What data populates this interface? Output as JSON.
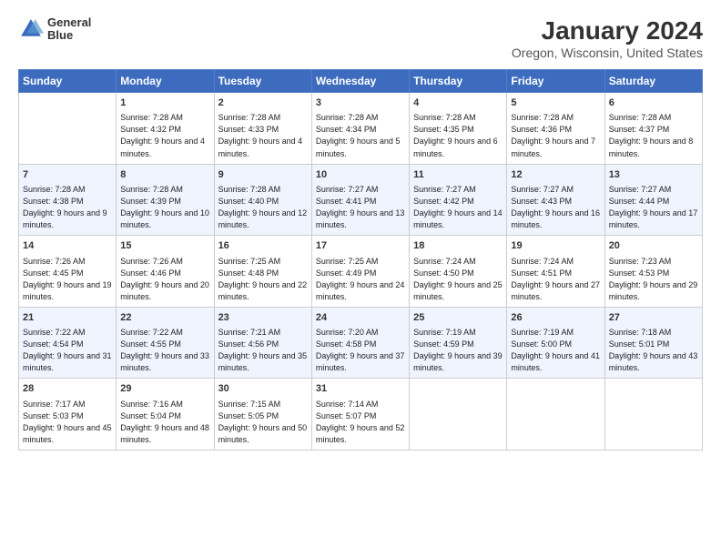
{
  "header": {
    "logo_line1": "General",
    "logo_line2": "Blue",
    "title": "January 2024",
    "subtitle": "Oregon, Wisconsin, United States"
  },
  "days_of_week": [
    "Sunday",
    "Monday",
    "Tuesday",
    "Wednesday",
    "Thursday",
    "Friday",
    "Saturday"
  ],
  "weeks": [
    [
      {
        "num": "",
        "sunrise": "",
        "sunset": "",
        "daylight": ""
      },
      {
        "num": "1",
        "sunrise": "Sunrise: 7:28 AM",
        "sunset": "Sunset: 4:32 PM",
        "daylight": "Daylight: 9 hours and 4 minutes."
      },
      {
        "num": "2",
        "sunrise": "Sunrise: 7:28 AM",
        "sunset": "Sunset: 4:33 PM",
        "daylight": "Daylight: 9 hours and 4 minutes."
      },
      {
        "num": "3",
        "sunrise": "Sunrise: 7:28 AM",
        "sunset": "Sunset: 4:34 PM",
        "daylight": "Daylight: 9 hours and 5 minutes."
      },
      {
        "num": "4",
        "sunrise": "Sunrise: 7:28 AM",
        "sunset": "Sunset: 4:35 PM",
        "daylight": "Daylight: 9 hours and 6 minutes."
      },
      {
        "num": "5",
        "sunrise": "Sunrise: 7:28 AM",
        "sunset": "Sunset: 4:36 PM",
        "daylight": "Daylight: 9 hours and 7 minutes."
      },
      {
        "num": "6",
        "sunrise": "Sunrise: 7:28 AM",
        "sunset": "Sunset: 4:37 PM",
        "daylight": "Daylight: 9 hours and 8 minutes."
      }
    ],
    [
      {
        "num": "7",
        "sunrise": "Sunrise: 7:28 AM",
        "sunset": "Sunset: 4:38 PM",
        "daylight": "Daylight: 9 hours and 9 minutes."
      },
      {
        "num": "8",
        "sunrise": "Sunrise: 7:28 AM",
        "sunset": "Sunset: 4:39 PM",
        "daylight": "Daylight: 9 hours and 10 minutes."
      },
      {
        "num": "9",
        "sunrise": "Sunrise: 7:28 AM",
        "sunset": "Sunset: 4:40 PM",
        "daylight": "Daylight: 9 hours and 12 minutes."
      },
      {
        "num": "10",
        "sunrise": "Sunrise: 7:27 AM",
        "sunset": "Sunset: 4:41 PM",
        "daylight": "Daylight: 9 hours and 13 minutes."
      },
      {
        "num": "11",
        "sunrise": "Sunrise: 7:27 AM",
        "sunset": "Sunset: 4:42 PM",
        "daylight": "Daylight: 9 hours and 14 minutes."
      },
      {
        "num": "12",
        "sunrise": "Sunrise: 7:27 AM",
        "sunset": "Sunset: 4:43 PM",
        "daylight": "Daylight: 9 hours and 16 minutes."
      },
      {
        "num": "13",
        "sunrise": "Sunrise: 7:27 AM",
        "sunset": "Sunset: 4:44 PM",
        "daylight": "Daylight: 9 hours and 17 minutes."
      }
    ],
    [
      {
        "num": "14",
        "sunrise": "Sunrise: 7:26 AM",
        "sunset": "Sunset: 4:45 PM",
        "daylight": "Daylight: 9 hours and 19 minutes."
      },
      {
        "num": "15",
        "sunrise": "Sunrise: 7:26 AM",
        "sunset": "Sunset: 4:46 PM",
        "daylight": "Daylight: 9 hours and 20 minutes."
      },
      {
        "num": "16",
        "sunrise": "Sunrise: 7:25 AM",
        "sunset": "Sunset: 4:48 PM",
        "daylight": "Daylight: 9 hours and 22 minutes."
      },
      {
        "num": "17",
        "sunrise": "Sunrise: 7:25 AM",
        "sunset": "Sunset: 4:49 PM",
        "daylight": "Daylight: 9 hours and 24 minutes."
      },
      {
        "num": "18",
        "sunrise": "Sunrise: 7:24 AM",
        "sunset": "Sunset: 4:50 PM",
        "daylight": "Daylight: 9 hours and 25 minutes."
      },
      {
        "num": "19",
        "sunrise": "Sunrise: 7:24 AM",
        "sunset": "Sunset: 4:51 PM",
        "daylight": "Daylight: 9 hours and 27 minutes."
      },
      {
        "num": "20",
        "sunrise": "Sunrise: 7:23 AM",
        "sunset": "Sunset: 4:53 PM",
        "daylight": "Daylight: 9 hours and 29 minutes."
      }
    ],
    [
      {
        "num": "21",
        "sunrise": "Sunrise: 7:22 AM",
        "sunset": "Sunset: 4:54 PM",
        "daylight": "Daylight: 9 hours and 31 minutes."
      },
      {
        "num": "22",
        "sunrise": "Sunrise: 7:22 AM",
        "sunset": "Sunset: 4:55 PM",
        "daylight": "Daylight: 9 hours and 33 minutes."
      },
      {
        "num": "23",
        "sunrise": "Sunrise: 7:21 AM",
        "sunset": "Sunset: 4:56 PM",
        "daylight": "Daylight: 9 hours and 35 minutes."
      },
      {
        "num": "24",
        "sunrise": "Sunrise: 7:20 AM",
        "sunset": "Sunset: 4:58 PM",
        "daylight": "Daylight: 9 hours and 37 minutes."
      },
      {
        "num": "25",
        "sunrise": "Sunrise: 7:19 AM",
        "sunset": "Sunset: 4:59 PM",
        "daylight": "Daylight: 9 hours and 39 minutes."
      },
      {
        "num": "26",
        "sunrise": "Sunrise: 7:19 AM",
        "sunset": "Sunset: 5:00 PM",
        "daylight": "Daylight: 9 hours and 41 minutes."
      },
      {
        "num": "27",
        "sunrise": "Sunrise: 7:18 AM",
        "sunset": "Sunset: 5:01 PM",
        "daylight": "Daylight: 9 hours and 43 minutes."
      }
    ],
    [
      {
        "num": "28",
        "sunrise": "Sunrise: 7:17 AM",
        "sunset": "Sunset: 5:03 PM",
        "daylight": "Daylight: 9 hours and 45 minutes."
      },
      {
        "num": "29",
        "sunrise": "Sunrise: 7:16 AM",
        "sunset": "Sunset: 5:04 PM",
        "daylight": "Daylight: 9 hours and 48 minutes."
      },
      {
        "num": "30",
        "sunrise": "Sunrise: 7:15 AM",
        "sunset": "Sunset: 5:05 PM",
        "daylight": "Daylight: 9 hours and 50 minutes."
      },
      {
        "num": "31",
        "sunrise": "Sunrise: 7:14 AM",
        "sunset": "Sunset: 5:07 PM",
        "daylight": "Daylight: 9 hours and 52 minutes."
      },
      {
        "num": "",
        "sunrise": "",
        "sunset": "",
        "daylight": ""
      },
      {
        "num": "",
        "sunrise": "",
        "sunset": "",
        "daylight": ""
      },
      {
        "num": "",
        "sunrise": "",
        "sunset": "",
        "daylight": ""
      }
    ]
  ]
}
